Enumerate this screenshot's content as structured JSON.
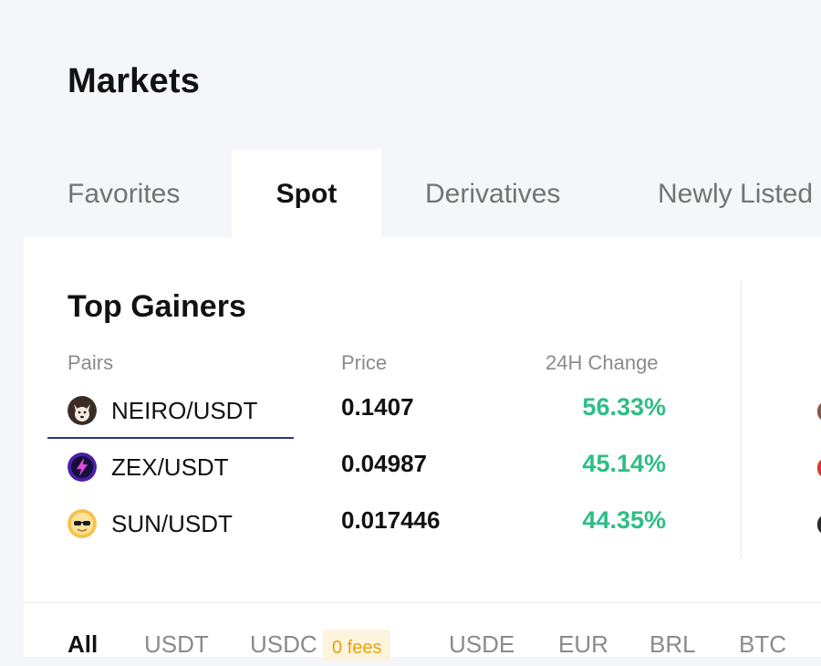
{
  "header": {
    "title": "Markets"
  },
  "tabs": [
    {
      "label": "Favorites"
    },
    {
      "label": "Spot"
    },
    {
      "label": "Derivatives"
    },
    {
      "label": "Newly Listed"
    }
  ],
  "top_gainers": {
    "title": "Top Gainers",
    "columns": {
      "pairs": "Pairs",
      "price": "Price",
      "change": "24H Change"
    },
    "rows": [
      {
        "pair": "NEIRO/USDT",
        "price": "0.1407",
        "change": "56.33%",
        "icon": "neiro-dog-icon"
      },
      {
        "pair": "ZEX/USDT",
        "price": "0.04987",
        "change": "45.14%",
        "icon": "zex-lightning-icon"
      },
      {
        "pair": "SUN/USDT",
        "price": "0.017446",
        "change": "44.35%",
        "icon": "sun-sunglasses-icon"
      }
    ]
  },
  "filters": {
    "items": [
      "All",
      "USDT",
      "USDC",
      "USDE",
      "EUR",
      "BRL",
      "BTC"
    ],
    "badge": "0 fees"
  },
  "colors": {
    "positive": "#2ebd85",
    "badge_bg": "#fdf4de",
    "badge_text": "#e8a20b",
    "underline": "#1f3b82"
  }
}
